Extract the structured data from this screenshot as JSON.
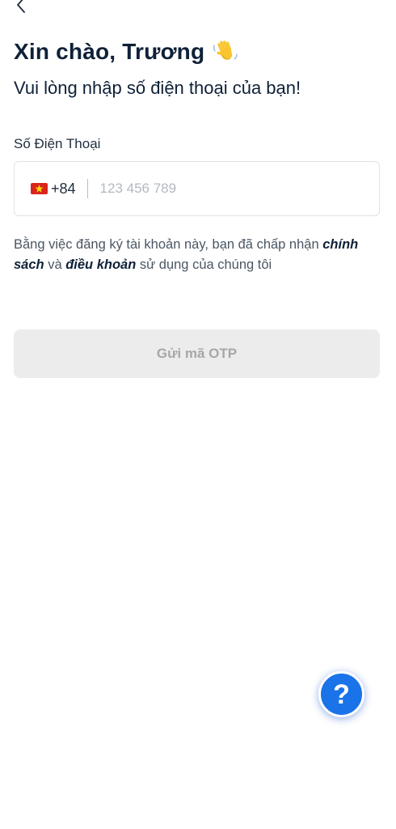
{
  "header": {
    "back_icon": "chevron-left-icon"
  },
  "greeting": {
    "title": "Xin chào, Trương",
    "emoji_icon": "waving-hand-icon"
  },
  "subtitle": "Vui lòng nhập số điện thoại của bạn!",
  "phone_field": {
    "label": "Số Điện Thoại",
    "country_flag": "vietnam-flag-icon",
    "country_code": "+84",
    "placeholder": "123 456 789",
    "value": ""
  },
  "terms": {
    "prefix": "Bằng việc đăng ký tài khoản này, bạn đã chấp nhận ",
    "policy_link": "chính sách",
    "middle": " và ",
    "terms_link": "điều khoản",
    "suffix": " sử dụng của chúng tôi"
  },
  "otp_button": {
    "label": "Gửi mã OTP",
    "enabled": false
  },
  "help_fab": {
    "label": "?",
    "icon": "question-mark-icon"
  },
  "colors": {
    "text_primary": "#0f2138",
    "button_disabled_bg": "#ececec",
    "button_disabled_text": "#a7a7a7",
    "help_button": "#1a73e8",
    "flag_red": "#da251d",
    "flag_star": "#ffdd00"
  }
}
